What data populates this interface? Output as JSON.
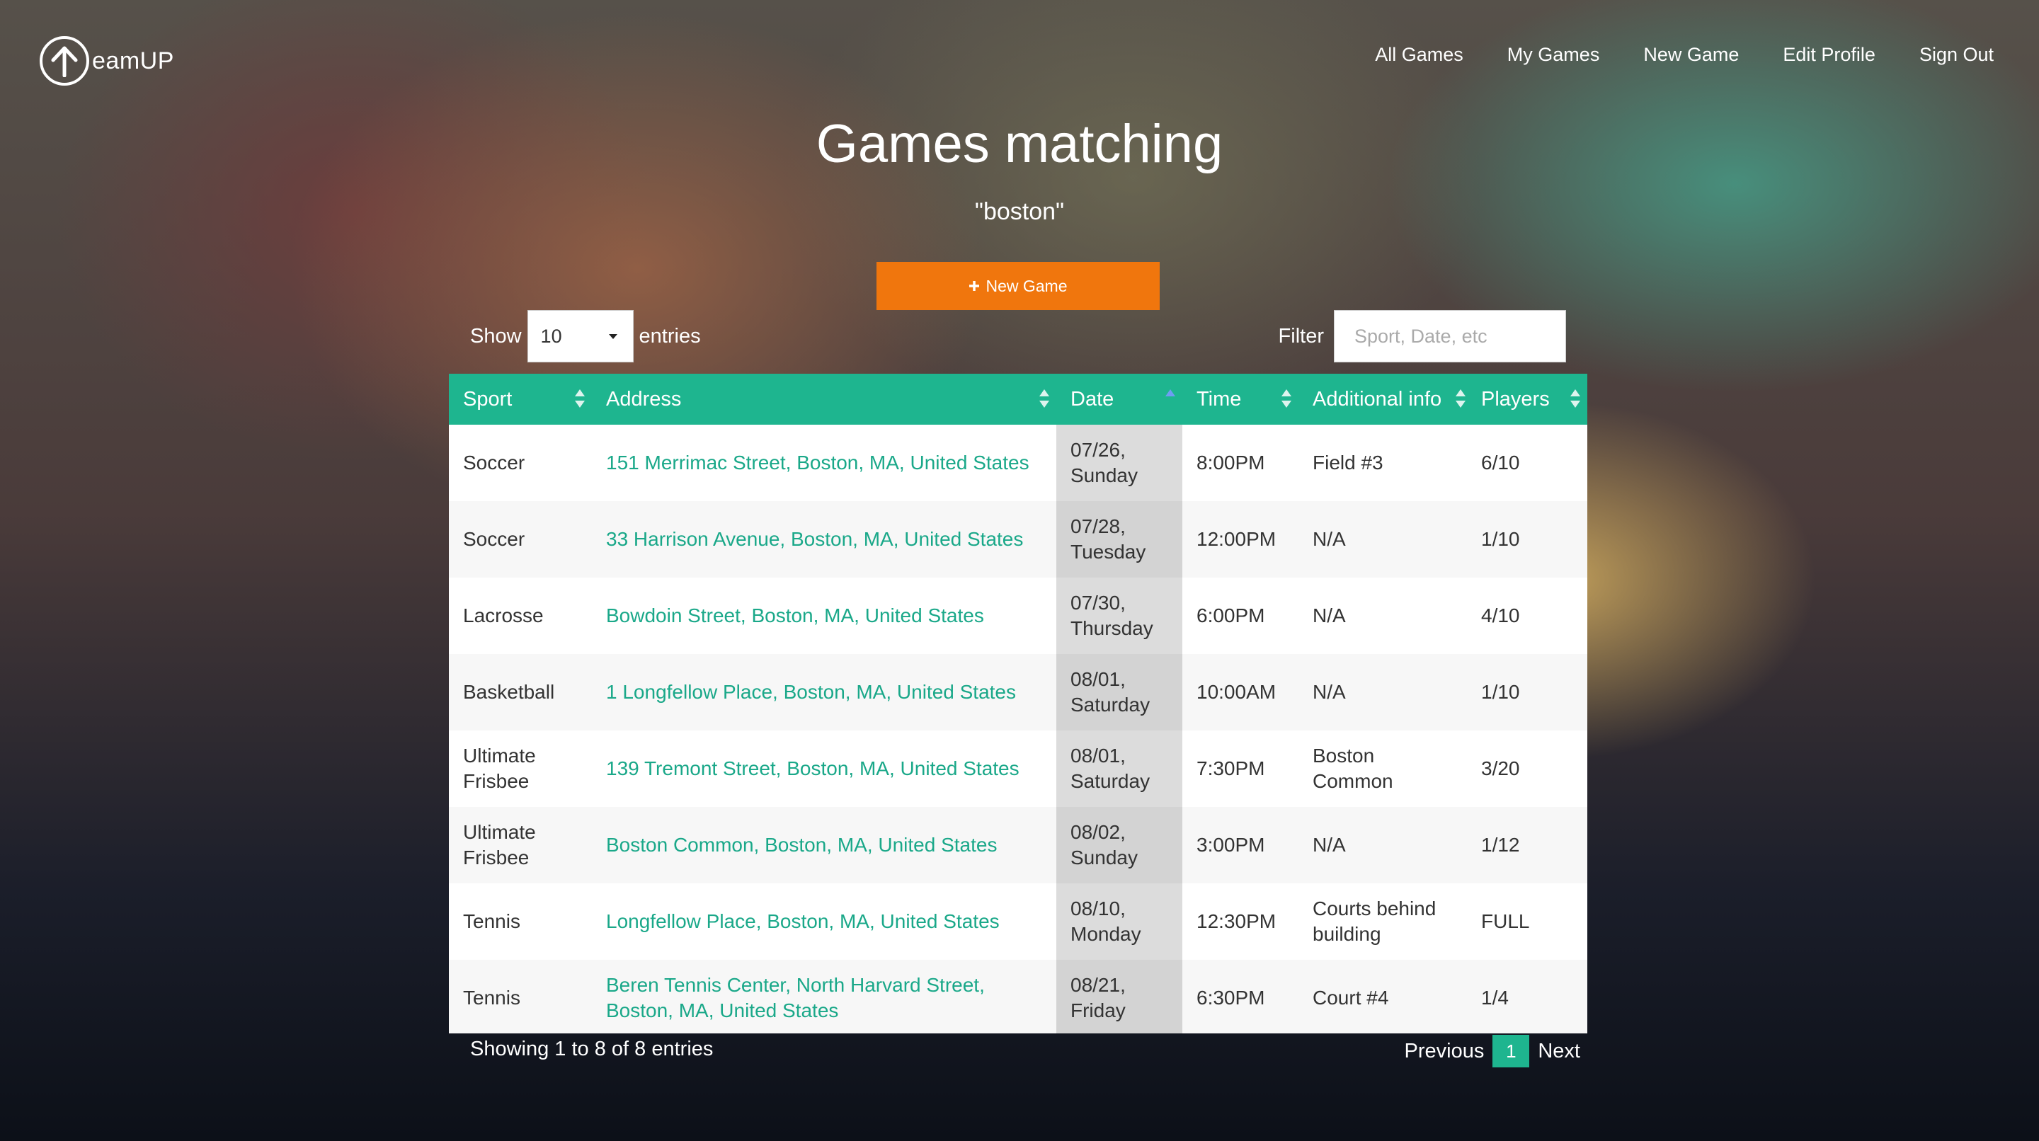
{
  "brand": {
    "name": "eamUP",
    "icon": "arrow-up-circle-icon"
  },
  "nav": [
    "All Games",
    "My Games",
    "New Game",
    "Edit Profile",
    "Sign Out"
  ],
  "page": {
    "title": "Games matching",
    "query": "\"boston\""
  },
  "new_game_button": {
    "icon": "plus-icon",
    "label": "New Game"
  },
  "length_control": {
    "prefix": "Show",
    "value": "10",
    "suffix": "entries"
  },
  "filter": {
    "label": "Filter",
    "placeholder": "Sport, Date, etc"
  },
  "table": {
    "headers": [
      "Sport",
      "Address",
      "Date",
      "Time",
      "Additional info",
      "Players"
    ],
    "rows": [
      {
        "sport": "Soccer",
        "address": "151 Merrimac Street, Boston, MA, United States",
        "date": [
          "07/26,",
          "Sunday"
        ],
        "time": "8:00PM",
        "info": "Field #3",
        "players": "6/10"
      },
      {
        "sport": "Soccer",
        "address": "33 Harrison Avenue, Boston, MA, United States",
        "date": [
          "07/28,",
          "Tuesday"
        ],
        "time": "12:00PM",
        "info": "N/A",
        "players": "1/10"
      },
      {
        "sport": "Lacrosse",
        "address": "Bowdoin Street, Boston, MA, United States",
        "date": [
          "07/30,",
          "Thursday"
        ],
        "time": "6:00PM",
        "info": "N/A",
        "players": "4/10"
      },
      {
        "sport": "Basketball",
        "address": "1 Longfellow Place, Boston, MA, United States",
        "date": [
          "08/01,",
          "Saturday"
        ],
        "time": "10:00AM",
        "info": "N/A",
        "players": "1/10"
      },
      {
        "sport": "Ultimate Frisbee",
        "address": "139 Tremont Street, Boston, MA, United States",
        "date": [
          "08/01,",
          "Saturday"
        ],
        "time": "7:30PM",
        "info": "Boston Common",
        "players": "3/20"
      },
      {
        "sport": "Ultimate Frisbee",
        "address": "Boston Common, Boston, MA, United States",
        "date": [
          "08/02,",
          "Sunday"
        ],
        "time": "3:00PM",
        "info": "N/A",
        "players": "1/12"
      },
      {
        "sport": "Tennis",
        "address": "Longfellow Place, Boston, MA, United States",
        "date": [
          "08/10,",
          "Monday"
        ],
        "time": "12:30PM",
        "info": "Courts behind building",
        "players": "FULL"
      },
      {
        "sport": "Tennis",
        "address": "Beren Tennis Center, North Harvard Street, Boston, MA, United States",
        "date": [
          "08/21,",
          "Friday"
        ],
        "time": "6:30PM",
        "info": "Court #4",
        "players": "1/4"
      }
    ]
  },
  "footer": {
    "info": "Showing 1 to 8 of 8 entries",
    "previous": "Previous",
    "current_page": "1",
    "next": "Next"
  },
  "colors": {
    "accent": "#1eb58f",
    "button": "#f0760d",
    "link": "#1aa889"
  }
}
